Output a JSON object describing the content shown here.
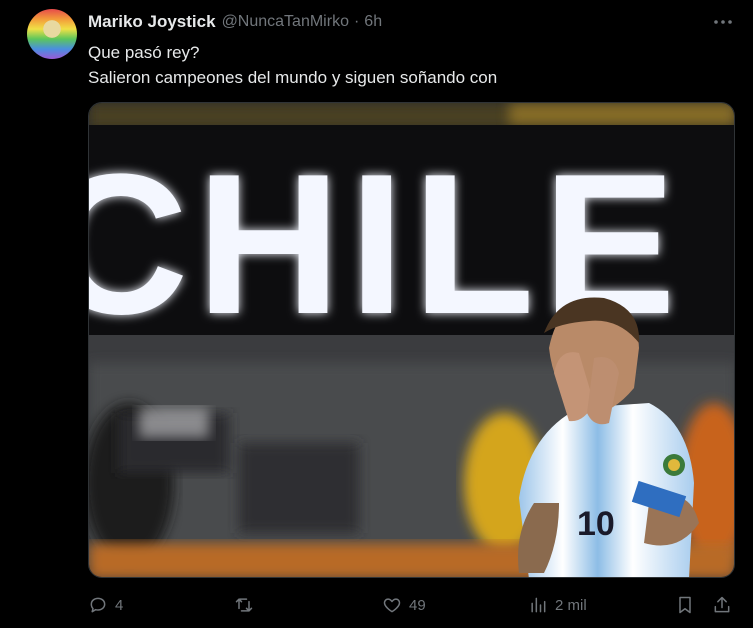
{
  "tweet": {
    "display_name": "Mariko Joystick",
    "handle": "@NuncaTanMirko",
    "separator": "·",
    "time": "6h",
    "text_lines": [
      "Que pasó rey?",
      "Salieron campeones del mundo y siguen soñando con"
    ],
    "media": {
      "scoreboard_text": "CHILE",
      "jersey_number": "10"
    },
    "actions": {
      "reply_count": "4",
      "like_count": "49",
      "views_count": "2 mil"
    }
  },
  "colors": {
    "background": "#000000",
    "text_primary": "#e7e9ea",
    "text_secondary": "#71767b",
    "border": "#2f3336"
  },
  "icons": [
    "more-icon",
    "reply-icon",
    "retweet-icon",
    "like-icon",
    "views-icon",
    "bookmark-icon",
    "share-icon"
  ]
}
